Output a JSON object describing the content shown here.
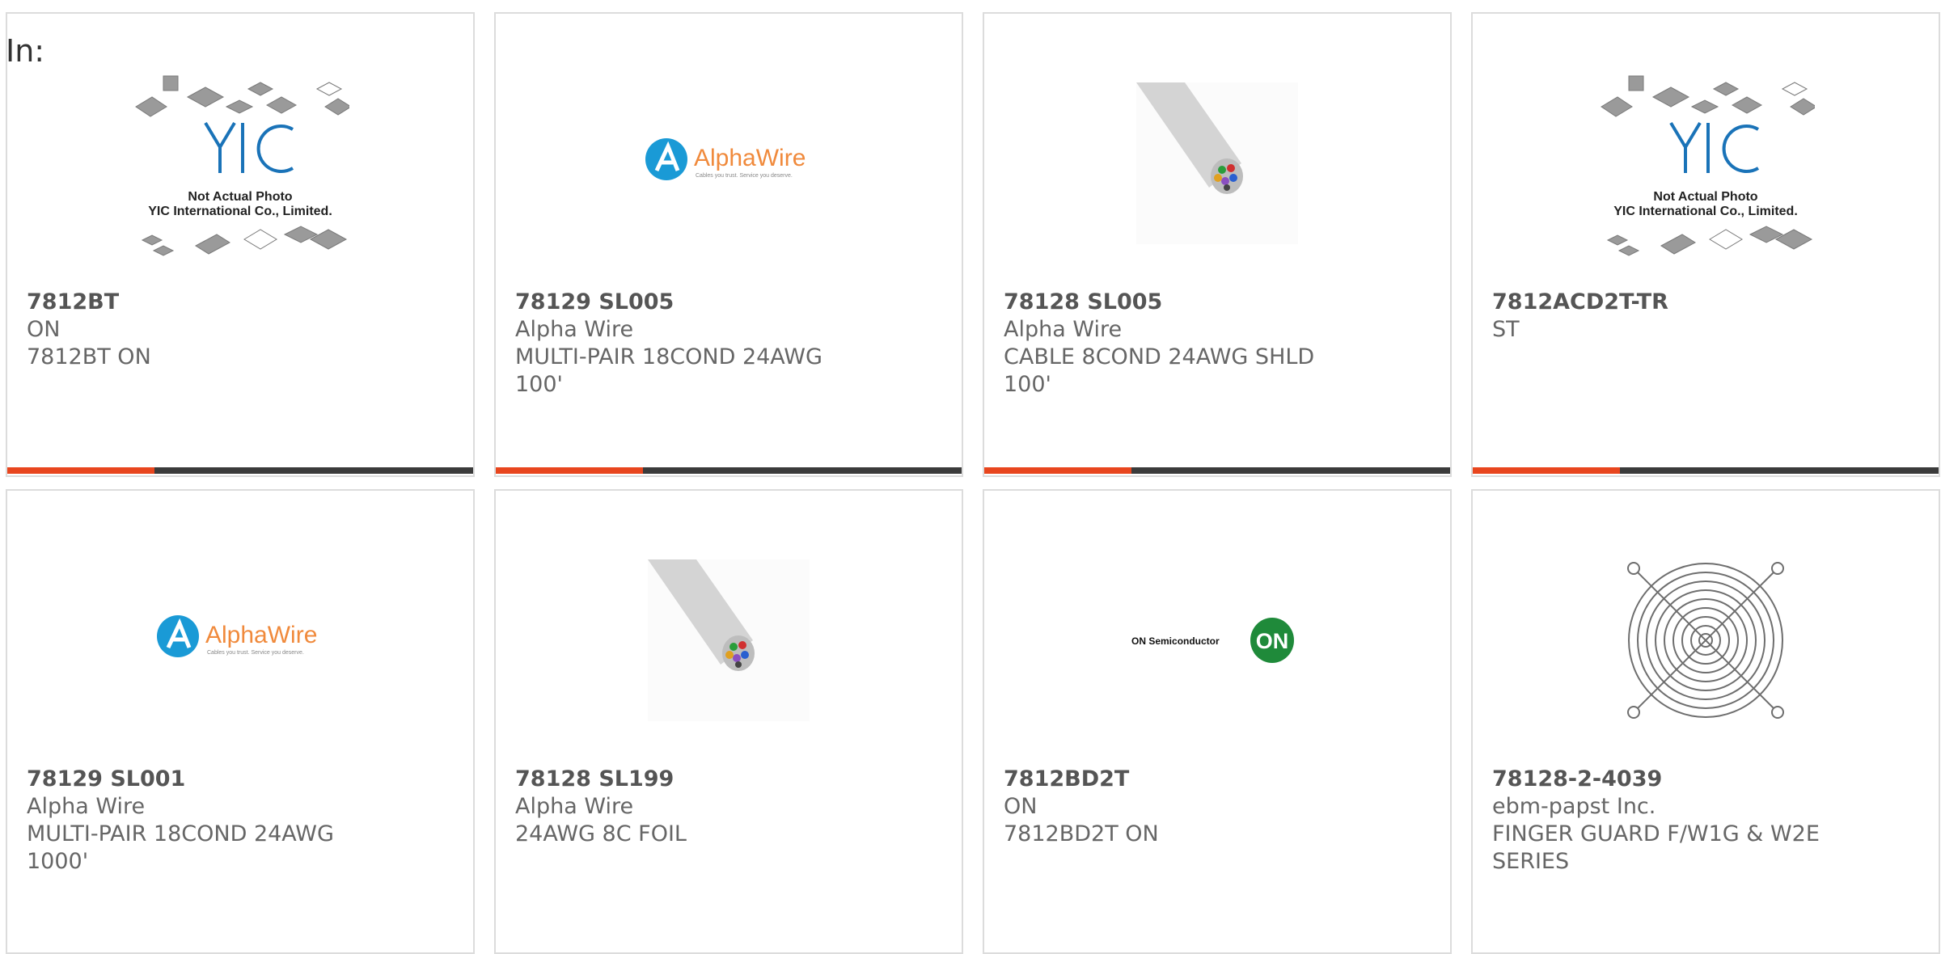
{
  "filter_label": "In:",
  "products": [
    {
      "part": "7812BT",
      "manufacturer": "ON",
      "description": "7812BT ON",
      "image": "yic-placeholder-photo",
      "placeholder_line1": "Not Actual Photo",
      "placeholder_line2": "YIC International Co., Limited."
    },
    {
      "part": "78129 SL005",
      "manufacturer": "Alpha Wire",
      "description": "MULTI-PAIR 18COND 24AWG 100'",
      "image": "alphawire-logo",
      "logo_text": "AlphaWire",
      "logo_tagline": "Cables you trust. Service you deserve."
    },
    {
      "part": "78128 SL005",
      "manufacturer": "Alpha Wire",
      "description": "CABLE 8COND 24AWG SHLD 100'",
      "image": "cable-photo"
    },
    {
      "part": "7812ACD2T-TR",
      "manufacturer": "ST",
      "description": "",
      "image": "yic-placeholder-photo",
      "placeholder_line1": "Not Actual Photo",
      "placeholder_line2": "YIC International Co., Limited."
    },
    {
      "part": "78129 SL001",
      "manufacturer": "Alpha Wire",
      "description": "MULTI-PAIR 18COND 24AWG 1000'",
      "image": "alphawire-logo",
      "logo_text": "AlphaWire",
      "logo_tagline": "Cables you trust. Service you deserve."
    },
    {
      "part": "78128 SL199",
      "manufacturer": "Alpha Wire",
      "description": "24AWG 8C FOIL",
      "image": "cable-photo"
    },
    {
      "part": "7812BD2T",
      "manufacturer": "ON",
      "description": "7812BD2T ON",
      "image": "on-semiconductor-logo",
      "logo_text": "ON Semiconductor",
      "logo_badge": "ON"
    },
    {
      "part": "78128-2-4039",
      "manufacturer": "ebm-papst Inc.",
      "description": "FINGER GUARD F/W1G & W2E SERIES",
      "image": "fan-guard-photo"
    }
  ],
  "colors": {
    "accent": "#e8461e",
    "bar": "#3b3b3b",
    "border": "#dcdcdc",
    "alphawire_blue": "#1a9ad6",
    "alphawire_orange": "#f08a3c",
    "on_green": "#1f8a3a"
  }
}
